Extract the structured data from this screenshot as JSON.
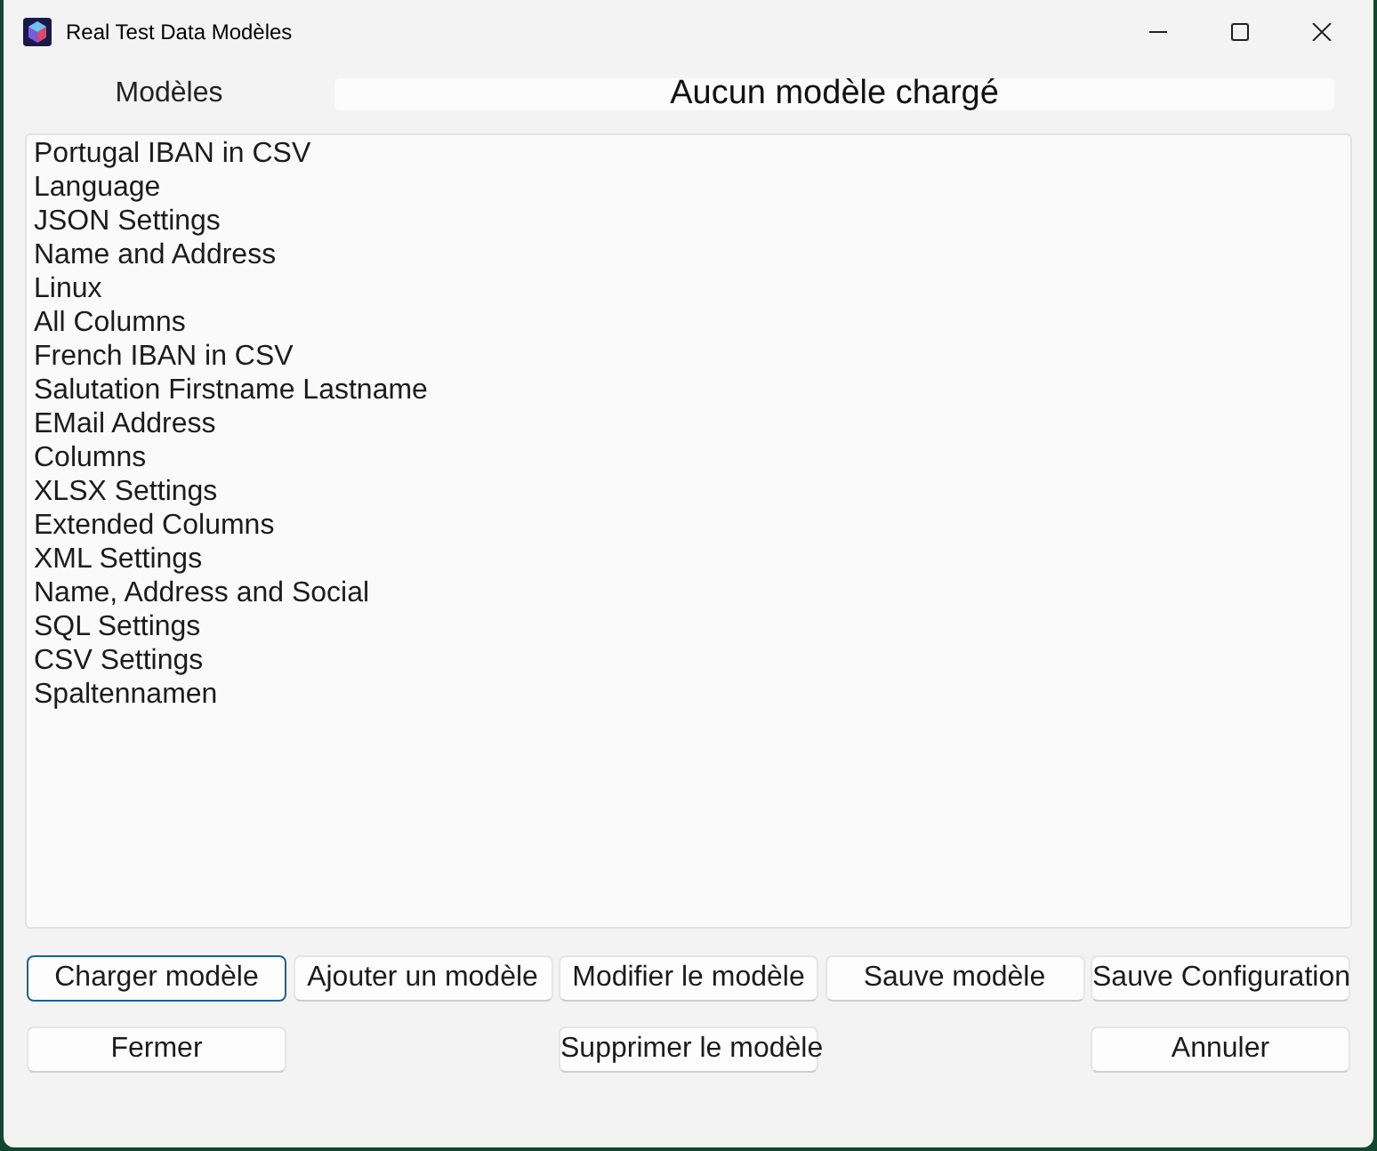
{
  "window": {
    "title": "Real Test Data Modèles"
  },
  "header": {
    "label": "Modèles",
    "status": "Aucun modèle chargé"
  },
  "models": [
    {
      "name": "Portugal IBAN in CSV"
    },
    {
      "name": "Language"
    },
    {
      "name": "JSON Settings"
    },
    {
      "name": "Name and Address"
    },
    {
      "name": "Linux"
    },
    {
      "name": "All Columns"
    },
    {
      "name": "French IBAN in CSV"
    },
    {
      "name": "Salutation Firstname Lastname"
    },
    {
      "name": "EMail Address"
    },
    {
      "name": "Columns"
    },
    {
      "name": "XLSX Settings"
    },
    {
      "name": "Extended Columns"
    },
    {
      "name": "XML Settings"
    },
    {
      "name": "Name, Address and Social"
    },
    {
      "name": "SQL Settings"
    },
    {
      "name": "CSV Settings"
    },
    {
      "name": "Spaltennamen"
    }
  ],
  "button_rows": [
    [
      {
        "label": "Charger modèle",
        "focused": true
      },
      {
        "label": "Ajouter un modèle",
        "focused": false
      },
      {
        "label": "Modifier le modèle",
        "focused": false
      },
      {
        "label": "Sauve modèle",
        "focused": false
      },
      {
        "label": "Sauve Configuration",
        "focused": false
      }
    ],
    [
      {
        "label": "Fermer",
        "focused": false
      },
      {
        "label": "Supprimer le modèle",
        "focused": false
      },
      {
        "label": "Annuler",
        "focused": false
      }
    ]
  ]
}
